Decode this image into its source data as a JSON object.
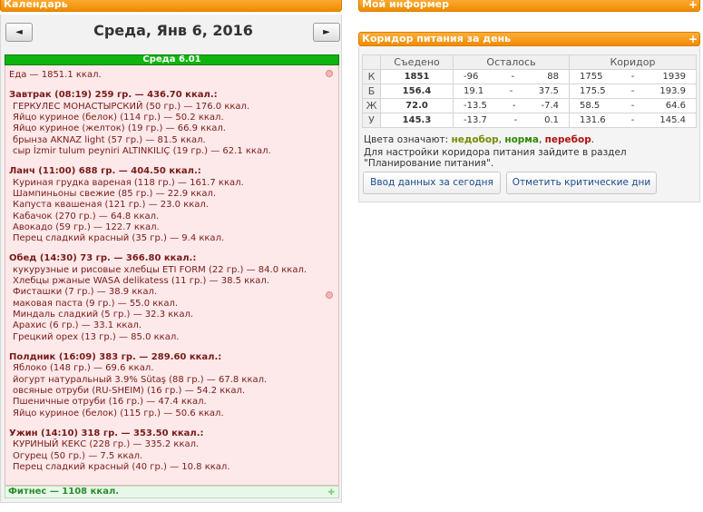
{
  "calendar": {
    "title": "Календарь",
    "prev_label": "◄",
    "next_label": "►",
    "date_label": "Среда, Янв 6, 2016",
    "day_bar": "Среда 6.01",
    "food_prefix": "Еда — ",
    "food_total": "1851.1 ккал.",
    "meals": [
      {
        "title": "Завтрак (08:19) 259 гр. — 436.70 ккал.:",
        "items": [
          "ГЕРКУЛЕС МОНАСТЫРСКИЙ (50 гр.) — 176.0 ккал.",
          "Яйцо куриное (белок) (114 гр.) — 50.2 ккал.",
          "Яйцо куриное (желток) (19 гр.) — 66.9 ккал.",
          "брынза AKNAZ light (57 гр.) — 81.5 ккал.",
          "сыр İzmir tulum peyniri ALTINKILIÇ (19 гр.) — 62.1 ккал."
        ]
      },
      {
        "title": "Ланч (11:00) 688 гр. — 404.50 ккал.:",
        "items": [
          "Куриная грудка вареная (118 гр.) — 161.7 ккал.",
          "Шампиньоны свежие (85 гр.) — 22.9 ккал.",
          "Капуста квашеная (121 гр.) — 23.0 ккал.",
          "Кабачок (270 гр.) — 64.8 ккал.",
          "Авокадо (59 гр.) — 122.7 ккал.",
          "Перец сладкий красный (35 гр.) — 9.4 ккал."
        ]
      },
      {
        "title": "Обед (14:30) 73 гр. — 366.80 ккал.:",
        "items": [
          "кукурузные и рисовые хлебцы ETI FORM (22 гр.) — 84.0 ккал.",
          "Хлебцы ржаные WASA delikatess (11 гр.) — 38.5 ккал.",
          "Фисташки (7 гр.) — 38.9 ккал.",
          "маковая паста (9 гр.) — 55.0 ккал.",
          "Миндаль сладкий (5 гр.) — 32.3 ккал.",
          "Арахис (6 гр.) — 33.1 ккал.",
          "Грецкий орех (13 гр.) — 85.0 ккал."
        ]
      },
      {
        "title": "Полдник (16:09) 383 гр. — 289.60 ккал.:",
        "items": [
          "Яблоко (148 гр.) — 69.6 ккал.",
          "йогурт натуральный 3.9% Sütaş (88 гр.) — 67.8 ккал.",
          "овсяные отруби (RU-SHEIM) (16 гр.) — 54.2 ккал.",
          "Пшеничные отруби (16 гр.) — 47.4 ккал.",
          "Яйцо куриное (белок) (115 гр.) — 50.6 ккал."
        ]
      },
      {
        "title": "Ужин (14:10) 318 гр. — 353.50 ккал.:",
        "items": [
          "КУРИНЫЙ КЕКС (228 гр.) — 335.2 ккал.",
          "Огурец (50 гр.) — 7.5 ккал.",
          "Перец сладкий красный (40 гр.) — 10.8 ккал."
        ]
      }
    ],
    "fitness": "Фитнес — 1108 ккал."
  },
  "informer": {
    "title": "Мой информер",
    "plus": "+"
  },
  "corridor": {
    "title": "Коридор питания за день",
    "plus": "+",
    "headers": {
      "eaten": "Съедено",
      "left": "Осталось",
      "corridor": "Коридор"
    },
    "rows": [
      {
        "label": "К",
        "eaten": "1851",
        "left_a": "-96",
        "sep": "-",
        "left_b": "88",
        "cor_a": "1755",
        "cor_b": "1939",
        "status_color": "#2e8b00"
      },
      {
        "label": "Б",
        "eaten": "156.4",
        "left_a": "19.1",
        "sep": "-",
        "left_b": "37.5",
        "cor_a": "175.5",
        "cor_b": "193.9",
        "status_color": "#8a8a00"
      },
      {
        "label": "Ж",
        "eaten": "72.0",
        "left_a": "-13.5",
        "sep": "-",
        "left_b": "-7.4",
        "cor_a": "58.5",
        "cor_b": "64.6",
        "status_color": "#b01010"
      },
      {
        "label": "У",
        "eaten": "145.3",
        "left_a": "-13.7",
        "sep": "-",
        "left_b": "0.1",
        "cor_a": "131.6",
        "cor_b": "145.4",
        "status_color": "#2e8b00"
      }
    ],
    "legend_prefix": "Цвета означают:",
    "legend_under": "недобор",
    "legend_norm": "норма",
    "legend_over": "перебор",
    "hint": "Для настройки коридора питания зайдите в раздел \"Планирование питания\".",
    "btn_enter": "Ввод данных за сегодня",
    "btn_crit": "Отметить критические дни"
  }
}
